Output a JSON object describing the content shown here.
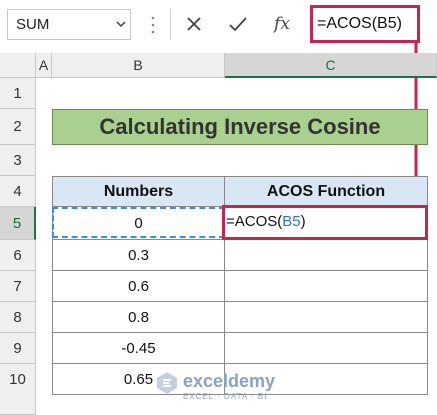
{
  "formula_bar": {
    "name_box": "SUM",
    "formula": "=ACOS(B5)",
    "icons": [
      "cancel-icon",
      "enter-icon",
      "function-icon"
    ],
    "fx_label": "fx"
  },
  "columns": [
    "A",
    "B",
    "C"
  ],
  "rows": [
    "1",
    "2",
    "3",
    "4",
    "5",
    "6",
    "7",
    "8",
    "9",
    "10"
  ],
  "sheet": {
    "title": "Calculating Inverse Cosine",
    "headers": [
      "Numbers",
      "ACOS Function"
    ],
    "numbers": [
      "0",
      "0.3",
      "0.6",
      "0.8",
      "-0.45",
      "0.65"
    ],
    "edit_prefix": "=ACOS(",
    "edit_ref": "B5",
    "edit_suffix": ")"
  },
  "watermark": {
    "name": "exceldemy",
    "tagline": "EXCEL · DATA · BI"
  },
  "colors": {
    "accent": "#c7254e",
    "title_bg": "#a9d08e",
    "header_bg": "#d9e7f5",
    "ref": "#2f6fc8"
  }
}
